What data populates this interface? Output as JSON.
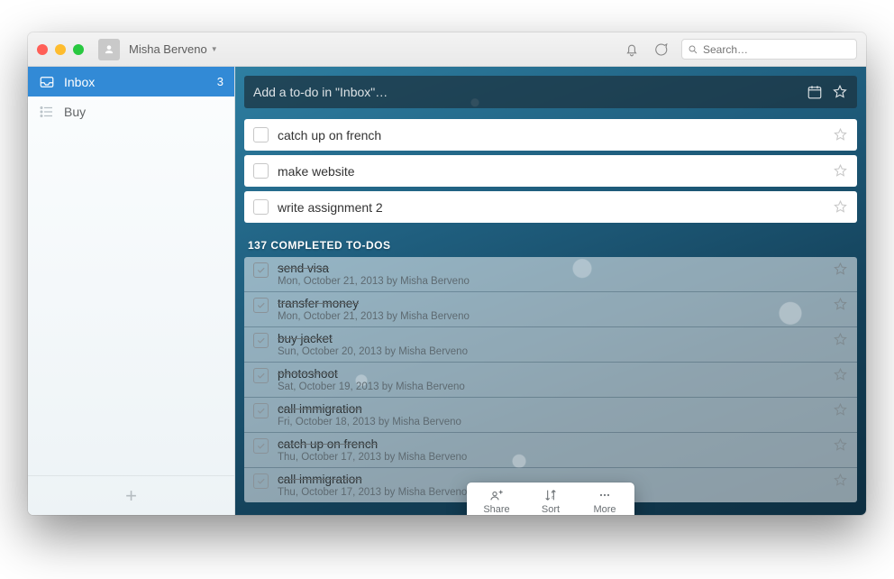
{
  "user_name": "Misha Berveno",
  "search_placeholder": "Search…",
  "sidebar": {
    "items": [
      {
        "name": "inbox",
        "label": "Inbox",
        "count": "3",
        "active": true
      },
      {
        "name": "buy",
        "label": "Buy",
        "count": "",
        "active": false
      }
    ]
  },
  "add_placeholder": "Add a to-do in \"Inbox\"…",
  "open_todos": [
    {
      "label": "catch up on french"
    },
    {
      "label": "make website"
    },
    {
      "label": "write assignment 2"
    }
  ],
  "completed_header": "137 COMPLETED TO-DOS",
  "completed_todos": [
    {
      "title": "send visa",
      "meta": "Mon, October 21, 2013 by Misha Berveno"
    },
    {
      "title": "transfer money",
      "meta": "Mon, October 21, 2013 by Misha Berveno"
    },
    {
      "title": "buy jacket",
      "meta": "Sun, October 20, 2013 by Misha Berveno"
    },
    {
      "title": "photoshoot",
      "meta": "Sat, October 19, 2013 by Misha Berveno"
    },
    {
      "title": "call immigration",
      "meta": "Fri, October 18, 2013 by Misha Berveno"
    },
    {
      "title": "catch up on french",
      "meta": "Thu, October 17, 2013 by Misha Berveno"
    },
    {
      "title": "call immigration",
      "meta": "Thu, October 17, 2013 by Misha Berveno"
    }
  ],
  "popover": {
    "share": "Share",
    "sort": "Sort",
    "more": "More"
  }
}
